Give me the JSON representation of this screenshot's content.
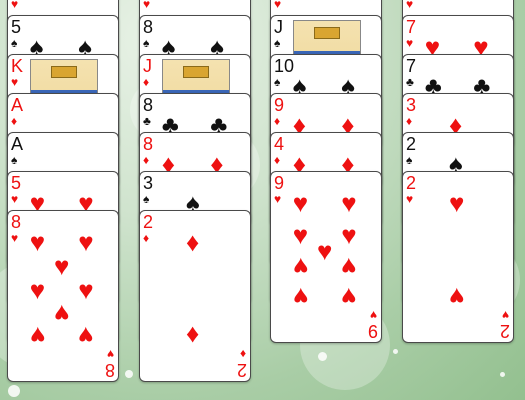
{
  "tableau": [
    {
      "name": "column-1",
      "cards": [
        {
          "rank": "",
          "suit": "heart"
        },
        {
          "rank": "5",
          "suit": "spade"
        },
        {
          "rank": "K",
          "suit": "heart"
        },
        {
          "rank": "A",
          "suit": "diamond"
        },
        {
          "rank": "A",
          "suit": "spade"
        },
        {
          "rank": "5",
          "suit": "heart"
        },
        {
          "rank": "8",
          "suit": "heart"
        }
      ]
    },
    {
      "name": "column-2",
      "cards": [
        {
          "rank": "",
          "suit": "heart"
        },
        {
          "rank": "8",
          "suit": "spade"
        },
        {
          "rank": "J",
          "suit": "diamond"
        },
        {
          "rank": "8",
          "suit": "club"
        },
        {
          "rank": "8",
          "suit": "diamond"
        },
        {
          "rank": "3",
          "suit": "spade"
        },
        {
          "rank": "2",
          "suit": "diamond"
        }
      ]
    },
    {
      "name": "column-3",
      "cards": [
        {
          "rank": "",
          "suit": "heart"
        },
        {
          "rank": "J",
          "suit": "spade"
        },
        {
          "rank": "10",
          "suit": "spade"
        },
        {
          "rank": "9",
          "suit": "diamond"
        },
        {
          "rank": "4",
          "suit": "diamond"
        },
        {
          "rank": "9",
          "suit": "heart"
        }
      ]
    },
    {
      "name": "column-4",
      "cards": [
        {
          "rank": "",
          "suit": "heart"
        },
        {
          "rank": "7",
          "suit": "heart"
        },
        {
          "rank": "7",
          "suit": "club"
        },
        {
          "rank": "3",
          "suit": "diamond"
        },
        {
          "rank": "2",
          "suit": "spade"
        },
        {
          "rank": "2",
          "suit": "heart"
        }
      ]
    }
  ],
  "colors": {
    "red_suit": "#ee1111",
    "black_suit": "#111111",
    "table_top": "#e8f2e6",
    "table_bottom": "#93c08f"
  }
}
